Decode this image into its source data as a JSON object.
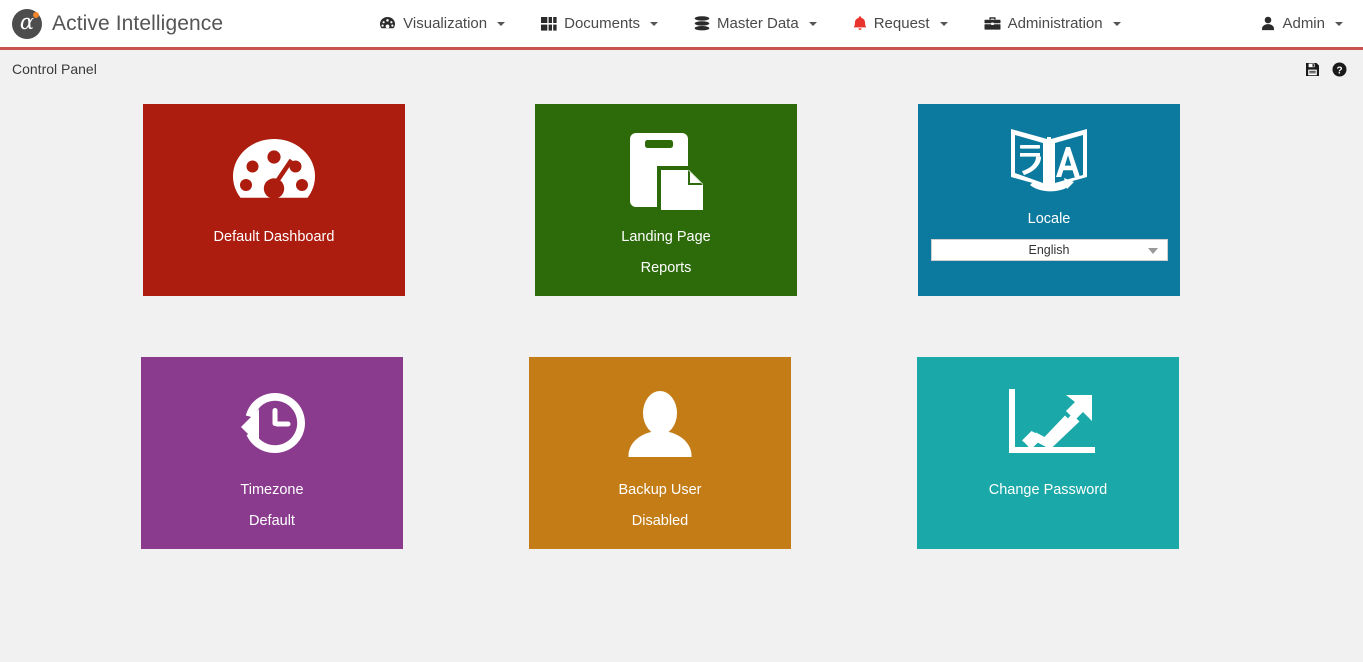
{
  "app": {
    "brand_name": "Active Intelligence",
    "logo_glyph": "α"
  },
  "navbar": {
    "items": [
      {
        "label": "Visualization",
        "icon": "dashboard-icon",
        "has_caret": true
      },
      {
        "label": "Documents",
        "icon": "grid-icon",
        "has_caret": true
      },
      {
        "label": "Master Data",
        "icon": "database-icon",
        "has_caret": true
      },
      {
        "label": "Request",
        "icon": "bell-icon",
        "has_caret": true
      },
      {
        "label": "Administration",
        "icon": "briefcase-icon",
        "has_caret": true
      }
    ],
    "user": {
      "label": "Admin",
      "icon": "user-icon",
      "has_caret": true
    }
  },
  "subheader": {
    "title": "Control Panel",
    "actions": [
      {
        "name": "save-icon",
        "title": "Save"
      },
      {
        "name": "help-icon",
        "title": "Help"
      }
    ]
  },
  "tiles": [
    {
      "id": "default-dashboard",
      "label": "Default Dashboard",
      "sub": "",
      "color": "#ac1d0f",
      "icon": "gauge-icon"
    },
    {
      "id": "landing-page",
      "label": "Landing Page",
      "sub": "Reports",
      "color": "#2d6a09",
      "icon": "documents-copy-icon"
    },
    {
      "id": "locale",
      "label": "Locale",
      "sub": "",
      "color": "#0c7a9e",
      "icon": "translate-icon",
      "select": {
        "value": "English",
        "options": [
          "English"
        ]
      }
    },
    {
      "id": "timezone",
      "label": "Timezone",
      "sub": "Default",
      "color": "#8b3b8e",
      "icon": "history-clock-icon"
    },
    {
      "id": "backup-user",
      "label": "Backup User",
      "sub": "Disabled",
      "color": "#c37c16",
      "icon": "user-silhouette-icon"
    },
    {
      "id": "change-password",
      "label": "Change Password",
      "sub": "",
      "color": "#1aa8a8",
      "icon": "chart-arrow-icon"
    }
  ],
  "theme": {
    "page_background": "#f1f1f1",
    "navbar_background": "#ffffff",
    "navbar_accent": "#c9534f",
    "brand_text_color": "#555555",
    "logo_background": "#4d4d4d",
    "logo_dot_color": "#f0852a"
  }
}
